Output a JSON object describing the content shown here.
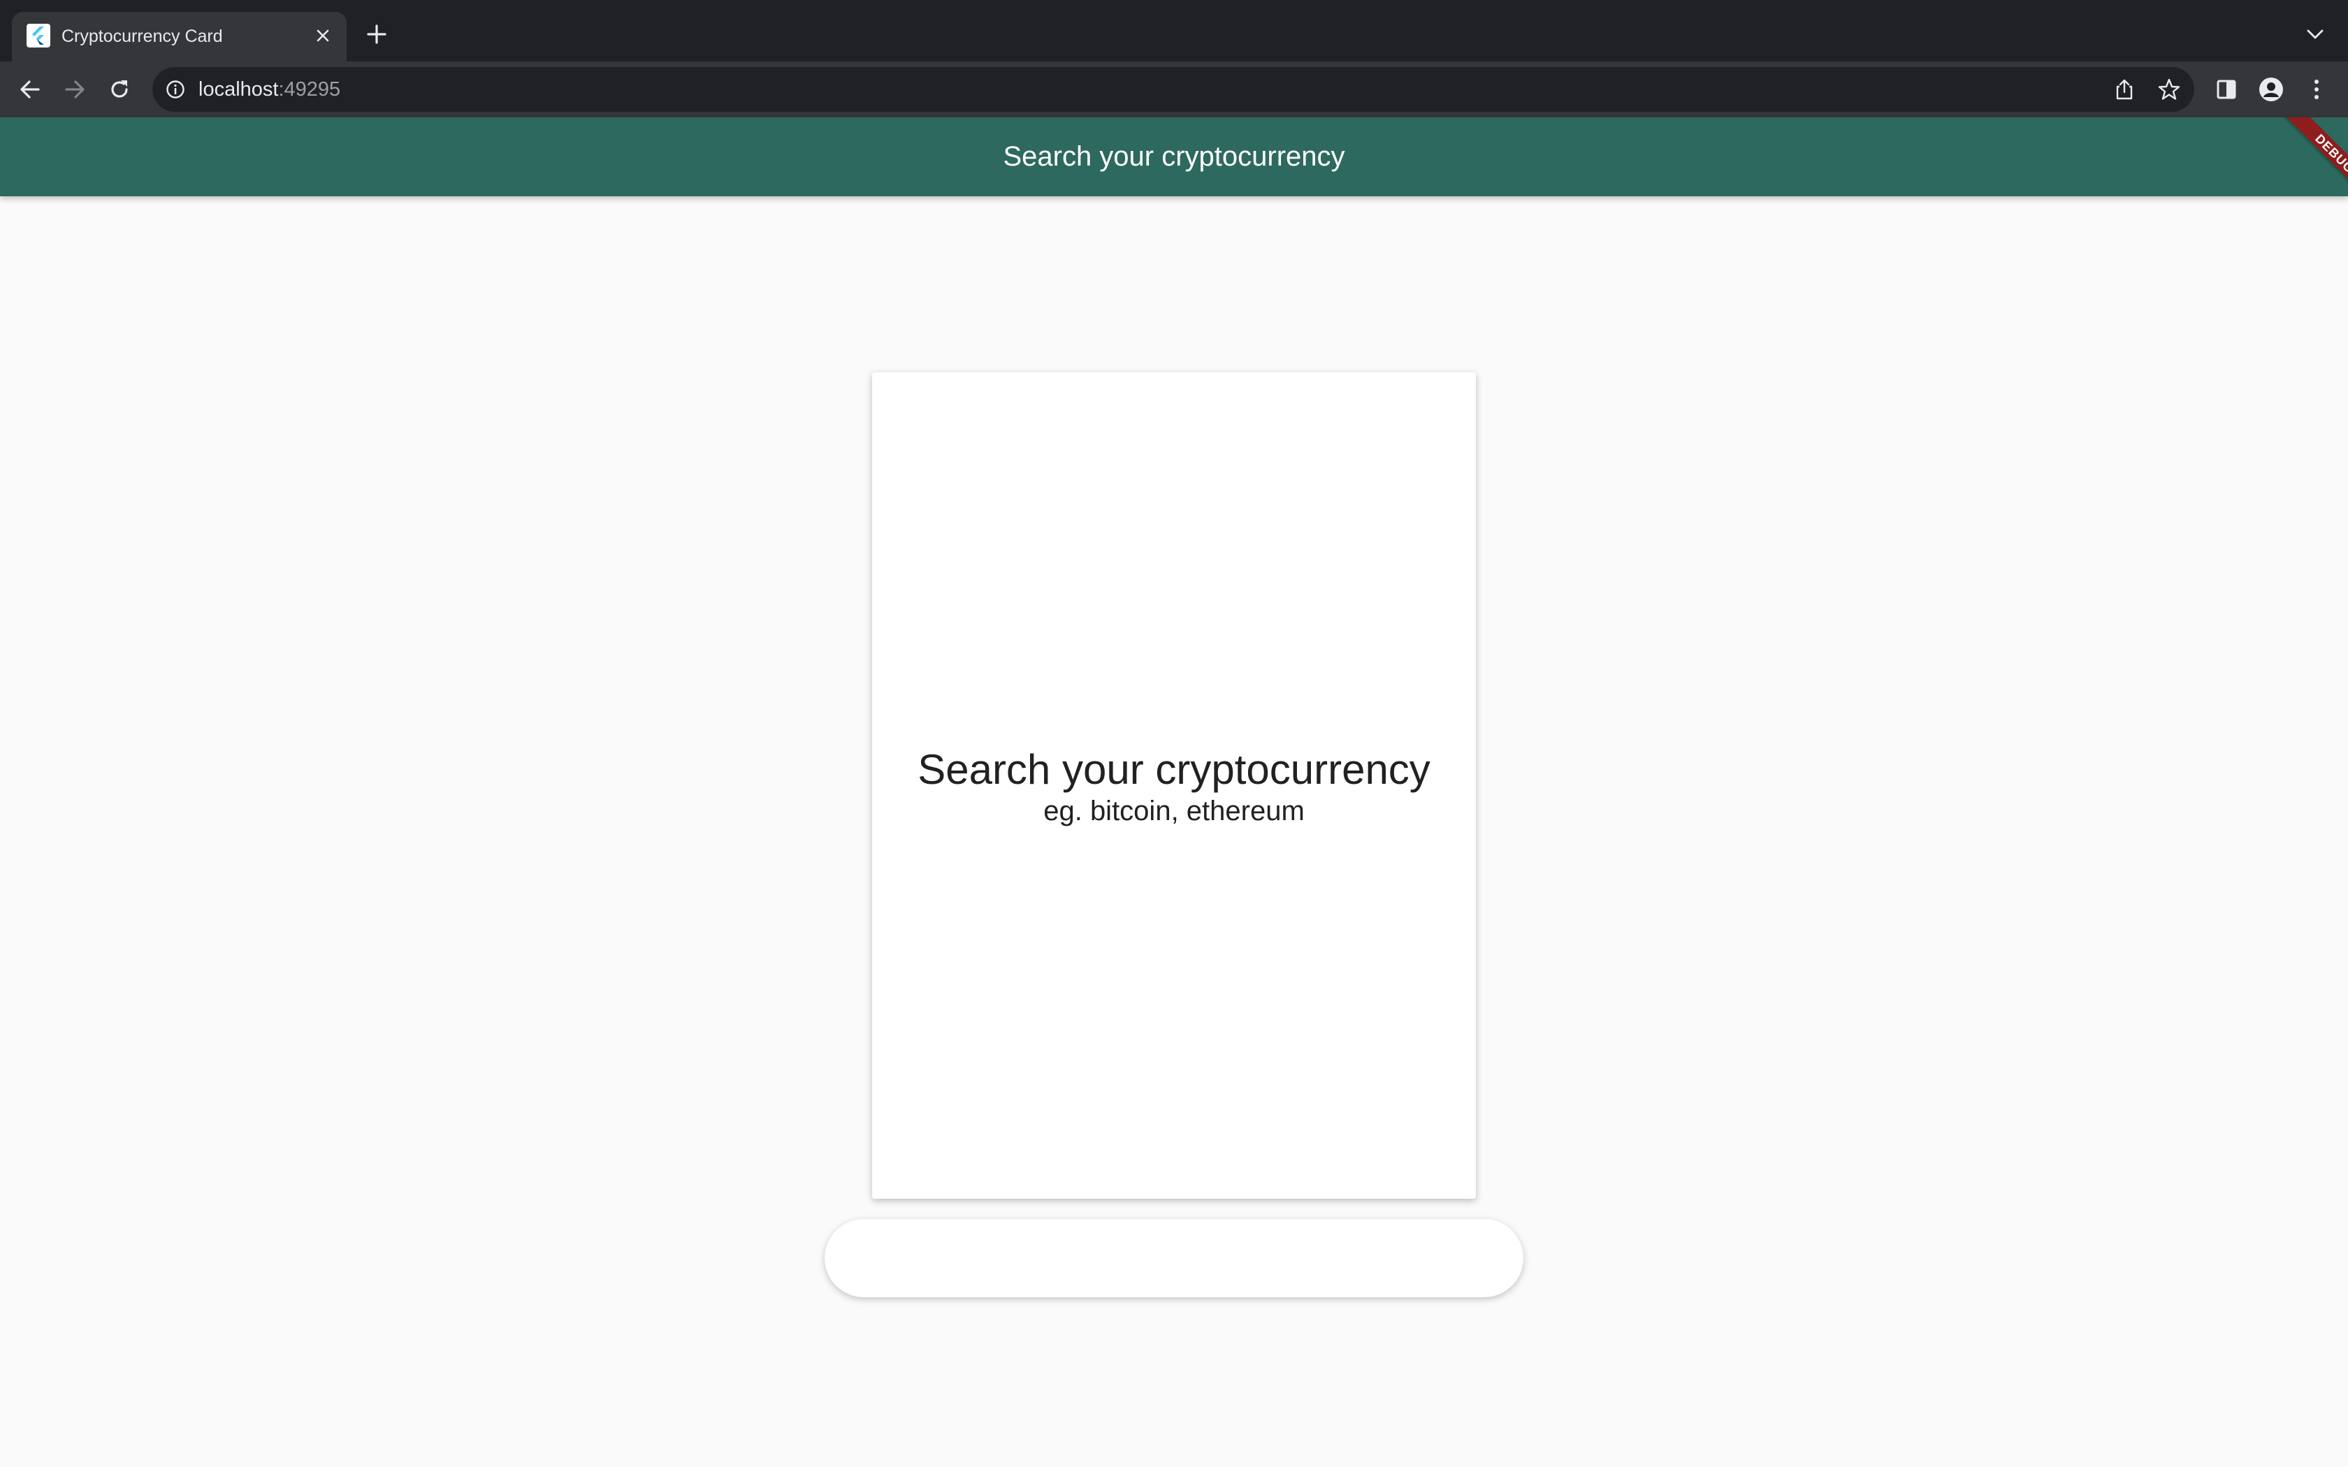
{
  "browser": {
    "tab": {
      "title": "Cryptocurrency Card",
      "favicon": "flutter-icon"
    },
    "address_bar": {
      "host": "localhost",
      "port": ":49295"
    },
    "icons": {
      "back": "arrow-left-icon",
      "forward": "arrow-right-icon",
      "reload": "reload-icon",
      "info": "info-icon",
      "share": "share-icon",
      "bookmark": "star-icon",
      "side_panel": "side-panel-icon",
      "profile": "profile-icon",
      "menu": "kebab-menu-icon"
    }
  },
  "app": {
    "appbar_title": "Search your cryptocurrency",
    "debug_banner": "DEBUG",
    "card": {
      "title": "Search your cryptocurrency",
      "subtitle": "eg. bitcoin, ethereum"
    },
    "search": {
      "value": "",
      "placeholder": ""
    },
    "colors": {
      "appbar": "#2d695e",
      "debug_ribbon": "#8e1d1d",
      "background": "#fafafa"
    }
  }
}
